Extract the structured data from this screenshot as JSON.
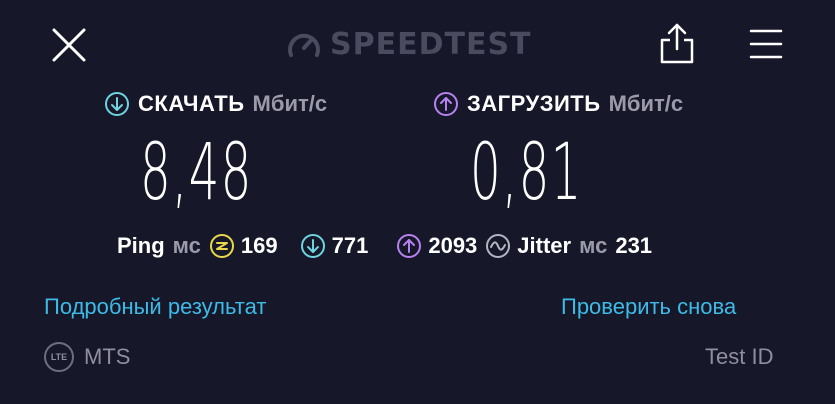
{
  "header": {
    "logo_text": "SPEEDTEST",
    "close_icon": "close-icon",
    "share_icon": "share-icon",
    "menu_icon": "hamburger-menu-icon"
  },
  "download": {
    "title": "СКАЧАТЬ",
    "unit": "Мбит/с",
    "value": "8,48",
    "icon": "download-arrow-icon",
    "color": "#6fd3e0"
  },
  "upload": {
    "title": "ЗАГРУЗИТЬ",
    "unit": "Мбит/с",
    "value": "0,81",
    "icon": "upload-arrow-icon",
    "color": "#b782f0"
  },
  "stats": {
    "ping_label": "Ping",
    "ping_unit": "мс",
    "ping_idle": "169",
    "ping_download": "771",
    "ping_upload": "2093",
    "jitter_label": "Jitter",
    "jitter_unit": "мс",
    "jitter_value": "231",
    "idle_color": "#e8d84a"
  },
  "links": {
    "details": "Подробный результат",
    "retest": "Проверить снова"
  },
  "footer": {
    "badge": "LTE",
    "provider": "MTS",
    "test_id": "Test ID"
  }
}
